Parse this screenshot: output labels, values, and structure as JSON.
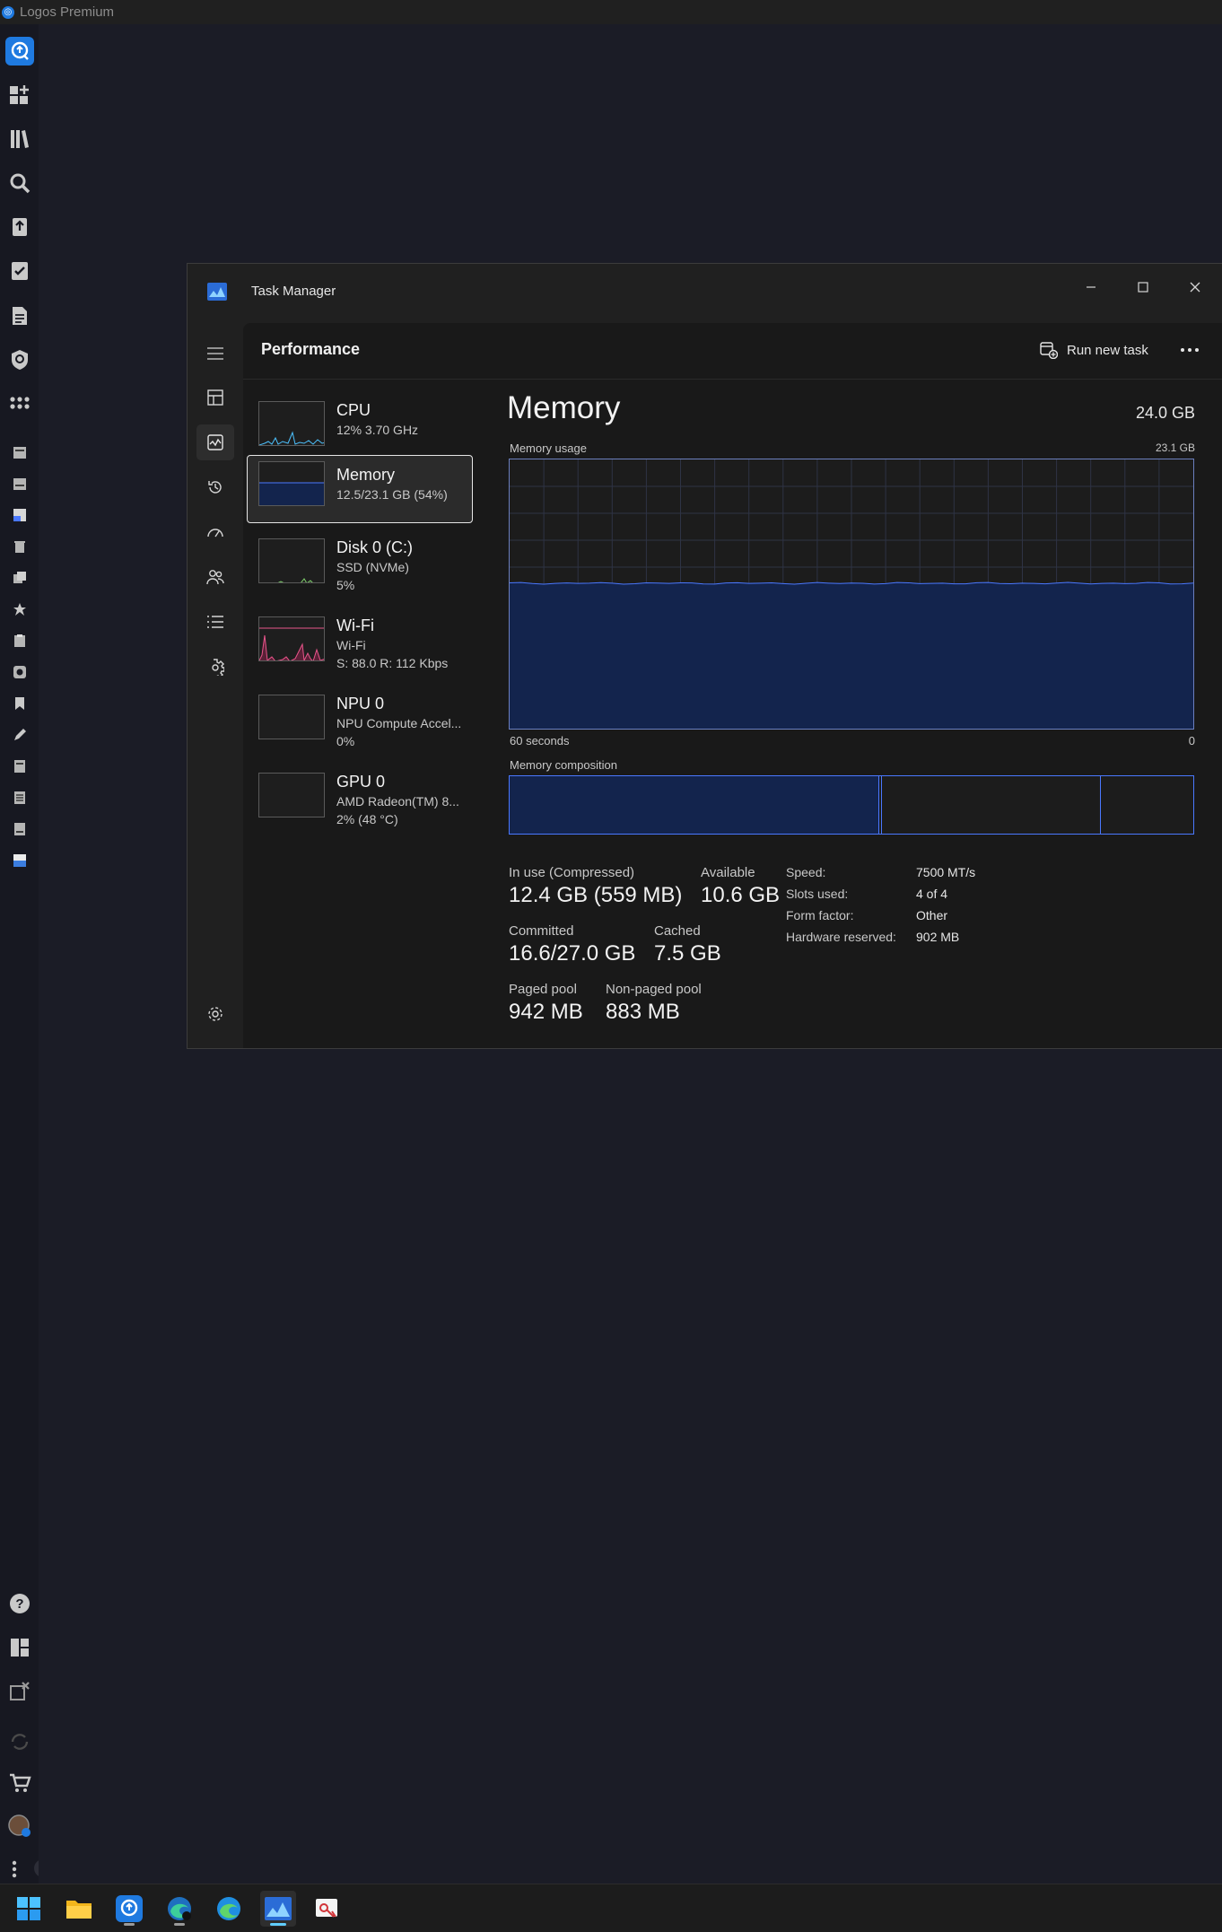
{
  "app": {
    "title": "Logos Premium"
  },
  "task_manager": {
    "title": "Task Manager",
    "page_title": "Performance",
    "run_new_task": "Run new task"
  },
  "devices": [
    {
      "name": "CPU",
      "line1": "12%  3.70 GHz",
      "line2": "",
      "graph_color": "#4cc2ff"
    },
    {
      "name": "Memory",
      "line1": "12.5/23.1 GB (54%)",
      "line2": "",
      "graph_color": "#4a78ff"
    },
    {
      "name": "Disk 0 (C:)",
      "line1": "SSD (NVMe)",
      "line2": "5%",
      "graph_color": "#7fd16b"
    },
    {
      "name": "Wi-Fi",
      "line1": "Wi-Fi",
      "line2": "S: 88.0  R: 112 Kbps",
      "graph_color": "#e8558b"
    },
    {
      "name": "NPU 0",
      "line1": "NPU Compute Accel...",
      "line2": "0%",
      "graph_color": "#5a5a5a"
    },
    {
      "name": "GPU 0",
      "line1": "AMD Radeon(TM) 8...",
      "line2": "2%  (48 °C)",
      "graph_color": "#5a5a5a"
    }
  ],
  "memory": {
    "heading": "Memory",
    "total": "24.0 GB",
    "usage_label": "Memory usage",
    "usage_max": "23.1 GB",
    "time_label": "60 seconds",
    "time_zero": "0",
    "composition_label": "Memory composition",
    "usage_fraction": 0.54,
    "composition": {
      "in_use": 0.54,
      "modified": 0.005,
      "standby": 0.32,
      "free": 0.135
    },
    "stats": {
      "in_use_label": "In use (Compressed)",
      "in_use_value": "12.4 GB (559 MB)",
      "available_label": "Available",
      "available_value": "10.6 GB",
      "committed_label": "Committed",
      "committed_value": "16.6/27.0 GB",
      "cached_label": "Cached",
      "cached_value": "7.5 GB",
      "paged_pool_label": "Paged pool",
      "paged_pool_value": "942 MB",
      "nonpaged_pool_label": "Non-paged pool",
      "nonpaged_pool_value": "883 MB"
    },
    "specs": {
      "speed_label": "Speed:",
      "speed_value": "7500 MT/s",
      "slots_label": "Slots used:",
      "slots_value": "4 of 4",
      "form_label": "Form factor:",
      "form_value": "Other",
      "reserved_label": "Hardware reserved:",
      "reserved_value": "902 MB"
    }
  },
  "colors": {
    "accent": "#60cdff",
    "memory_fill": "#13244d",
    "memory_line": "#4a78ff",
    "sidebar_accent": "#1f7ae0"
  },
  "taskbar_icons": [
    "windows-start-icon",
    "file-explorer-icon",
    "logos-icon",
    "edge-dev-icon",
    "edge-icon",
    "task-manager-icon",
    "snipping-tool-icon"
  ]
}
